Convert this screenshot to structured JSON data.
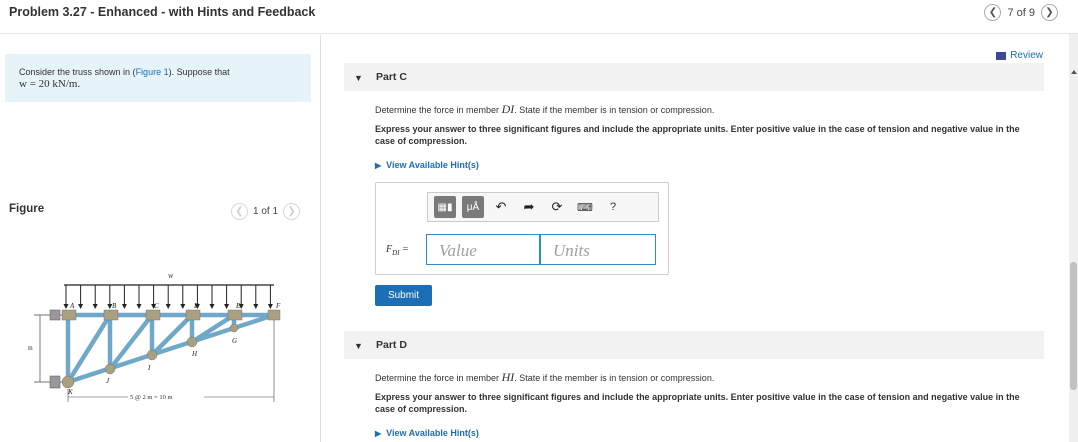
{
  "header": {
    "title": "Problem 3.27 - Enhanced - with Hints and Feedback",
    "prev_icon": "chevron-left-icon",
    "next_icon": "chevron-right-icon",
    "page_counter": "7 of 9"
  },
  "problem": {
    "text_before_link": "Consider the truss shown in (",
    "link": "Figure 1",
    "text_after_link": "). Suppose that",
    "load_eq": "w = 20 kN/m."
  },
  "figure": {
    "label": "Figure",
    "counter": "1 of 1",
    "truss": {
      "load_label": "w",
      "joints": [
        "A",
        "B",
        "C",
        "D",
        "E",
        "F",
        "G",
        "H",
        "I",
        "J",
        "K"
      ],
      "height_label": "3 m",
      "span_label": "5 @ 2 m = 10 m"
    }
  },
  "review": {
    "label": "Review",
    "icon": "review-icon"
  },
  "partC": {
    "label": "Part C",
    "question_pre": "Determine the force in member ",
    "member": "DI",
    "question_post": ". State if the member is in tension or compression.",
    "instructions": "Express your answer to three significant figures and include the appropriate units. Enter positive value in the case of tension and negative value in the case of compression.",
    "hint": "View Available Hint(s)",
    "toolbar": {
      "templates_icon": "templates-icon",
      "units_label": "μÅ",
      "undo_icon": "undo-icon",
      "redo_icon": "redo-icon",
      "reset_icon": "reset-icon",
      "keyboard_icon": "keyboard-icon",
      "help_label": "?"
    },
    "answer_label": "FDI =",
    "answer_label_main": "F",
    "answer_label_sub": "DI",
    "answer_label_eq": " =",
    "value_placeholder": "Value",
    "units_placeholder": "Units",
    "submit": "Submit"
  },
  "partD": {
    "label": "Part D",
    "question_pre": "Determine the force in member ",
    "member": "HI",
    "question_post": ". State if the member is in tension or compression.",
    "instructions": "Express your answer to three significant figures and include the appropriate units. Enter positive value in the case of tension and negative value in the case of compression.",
    "hint": "View Available Hint(s)"
  }
}
